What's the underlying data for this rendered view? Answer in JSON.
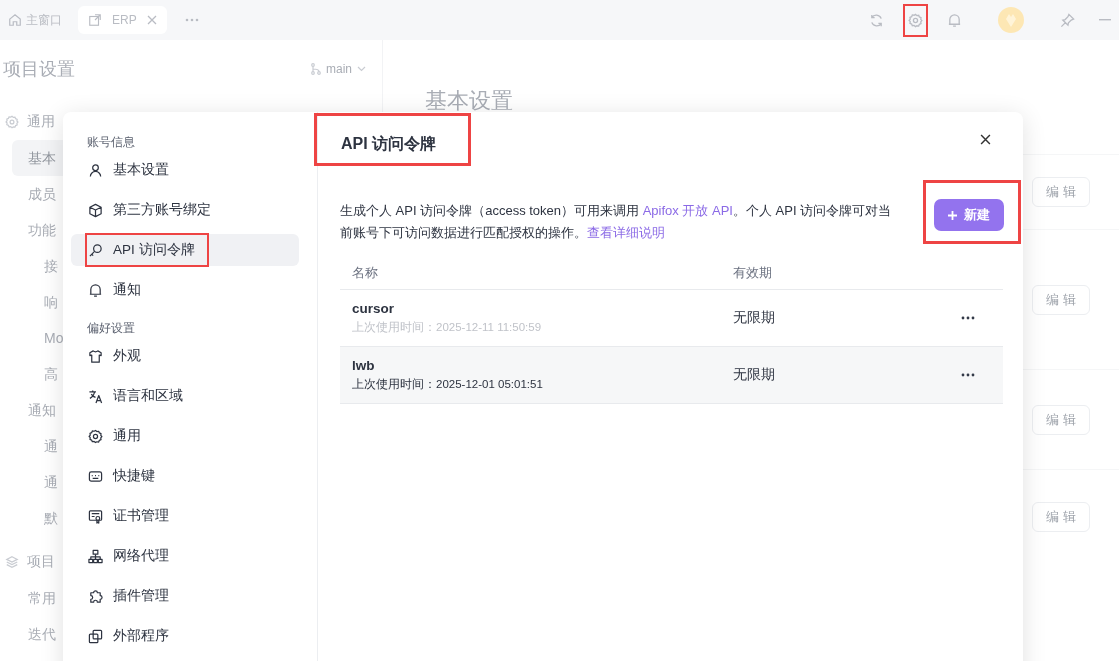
{
  "topbar": {
    "home": {
      "label": "主窗口"
    },
    "tabs": [
      {
        "label": "ERP"
      }
    ],
    "toolbar": [
      {
        "kind": "refresh",
        "highlighted": false
      },
      {
        "kind": "settings",
        "highlighted": true
      },
      {
        "kind": "bell",
        "highlighted": false
      },
      {
        "kind": "avatar",
        "highlighted": false
      },
      {
        "kind": "pin",
        "highlighted": false
      },
      {
        "kind": "minimize",
        "highlighted": false
      }
    ]
  },
  "background": {
    "sidebar": {
      "title": "项目设置",
      "branch": "main",
      "items": [
        {
          "label": "通用",
          "children": [
            {
              "label": "基本",
              "selected": true
            },
            {
              "label": "成员",
              "selected": false
            },
            {
              "label": "功能",
              "selected": false,
              "children": [
                {
                  "label": "接",
                  "selected": false
                },
                {
                  "label": "响",
                  "selected": false
                },
                {
                  "label": "Mo",
                  "selected": false
                },
                {
                  "label": "高",
                  "selected": false
                }
              ]
            },
            {
              "label": "通知",
              "selected": false,
              "children": [
                {
                  "label": "通",
                  "selected": false
                },
                {
                  "label": "通",
                  "selected": false
                },
                {
                  "label": "默",
                  "selected": false
                }
              ]
            }
          ]
        },
        {
          "label": "项目",
          "children": [
            {
              "label": "常用",
              "selected": false
            },
            {
              "label": "迭代",
              "selected": false
            }
          ]
        }
      ]
    },
    "page_title": "基本设置",
    "edit_buttons": [
      "编 辑",
      "编 辑",
      "编 辑",
      "编 辑"
    ]
  },
  "dialog": {
    "nav": [
      {
        "section": "账号信息",
        "items": [
          {
            "label": "基本设置",
            "selected": false,
            "highlighted": false
          },
          {
            "label": "第三方账号绑定",
            "selected": false,
            "highlighted": false
          },
          {
            "label": "API 访问令牌",
            "selected": true,
            "highlighted": true
          },
          {
            "label": "通知",
            "selected": false,
            "highlighted": false
          }
        ]
      },
      {
        "section": "偏好设置",
        "items": [
          {
            "label": "外观",
            "selected": false,
            "highlighted": false
          },
          {
            "label": "语言和区域",
            "selected": false,
            "highlighted": false
          },
          {
            "label": "通用",
            "selected": false,
            "highlighted": false
          },
          {
            "label": "快捷键",
            "selected": false,
            "highlighted": false
          },
          {
            "label": "证书管理",
            "selected": false,
            "highlighted": false
          },
          {
            "label": "网络代理",
            "selected": false,
            "highlighted": false
          },
          {
            "label": "插件管理",
            "selected": false,
            "highlighted": false
          },
          {
            "label": "外部程序",
            "selected": false,
            "highlighted": false
          }
        ]
      }
    ],
    "title": "API 访问令牌",
    "title_highlighted": true,
    "description": [
      {
        "kind": "text",
        "text": "生成个人 API 访问令牌（access token）可用来调用 "
      },
      {
        "kind": "link",
        "text": "Apifox 开放 API"
      },
      {
        "kind": "text",
        "text": "。个人 API 访问令牌可对当前账号下可访问数据进行匹配授权的操作。"
      },
      {
        "kind": "link",
        "text": "查看详细说明"
      }
    ],
    "new_button": {
      "label": "新建",
      "highlighted": true
    },
    "table": {
      "columns": [
        "名称",
        "有效期"
      ],
      "rows": [
        {
          "name": "cursor",
          "last_used": "上次使用时间：2025-12-11 11:50:59",
          "expiry": "无限期",
          "hovered": false
        },
        {
          "name": "lwb",
          "last_used": "上次使用时间：2025-12-01 05:01:51",
          "expiry": "无限期",
          "hovered": true
        }
      ]
    }
  }
}
